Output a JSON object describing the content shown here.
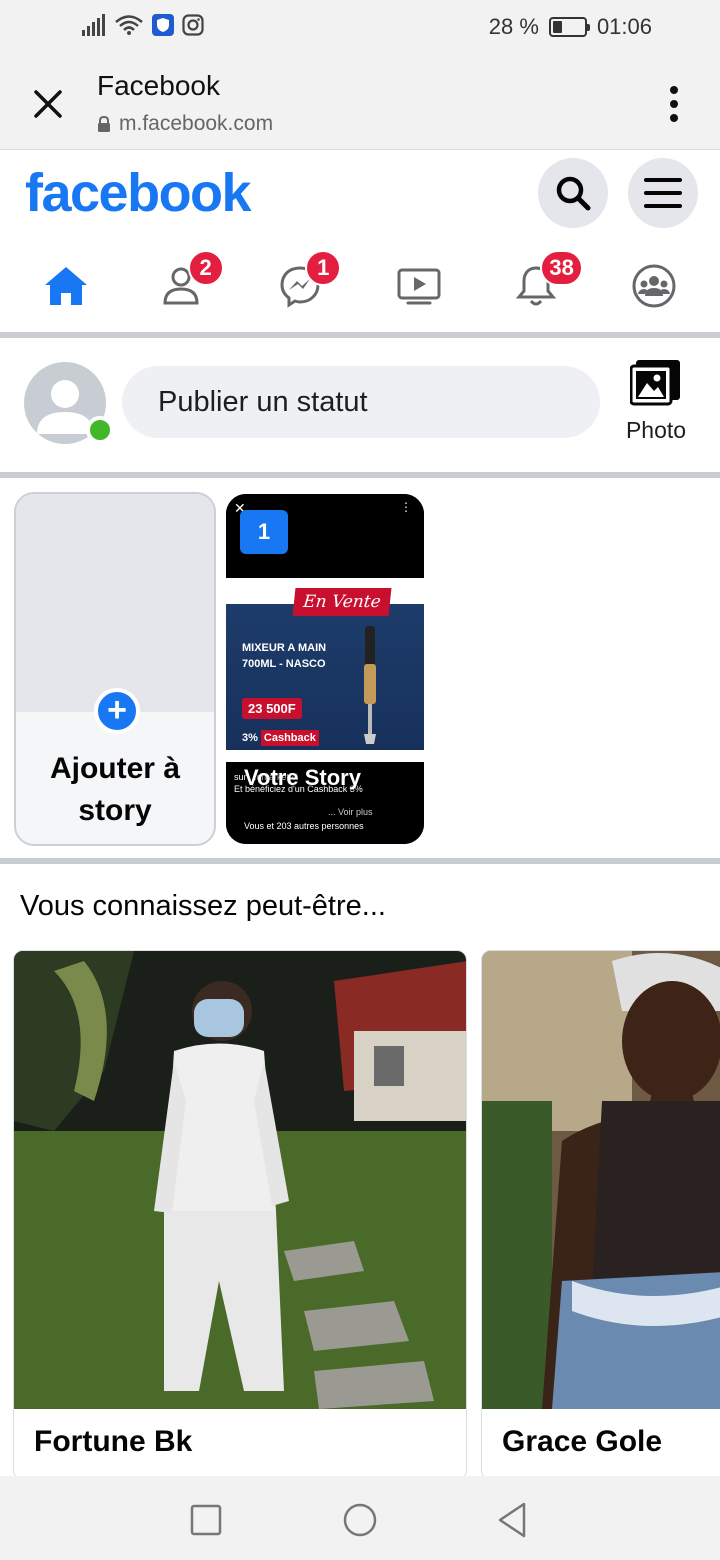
{
  "status_bar": {
    "battery": "28 %",
    "battery_level_percent": 28,
    "time": "01:06"
  },
  "browser": {
    "title": "Facebook",
    "url": "m.facebook.com"
  },
  "header": {
    "logo": "facebook"
  },
  "nav": {
    "friends_badge": "2",
    "messenger_badge": "1",
    "notifications_badge": "38"
  },
  "composer": {
    "placeholder": "Publier un statut",
    "photo_label": "Photo"
  },
  "stories": {
    "add_label": "Ajouter à story",
    "card": {
      "number": "1",
      "ad_banner": "En Vente",
      "ad_title": "MIXEUR A MAIN 700ML - NASCO",
      "ad_price": "23 500F",
      "ad_cashback_prefix": "3%",
      "ad_cashback": "Cashback",
      "line1": "sur ...dmarket.ci",
      "line2": "Et bénéficiez d'un Cashback 3%",
      "see_more": "... Voir plus",
      "likes": "Vous et 203 autres personnes",
      "label": "Votre Story"
    }
  },
  "pymk": {
    "title": "Vous connaissez peut-être...",
    "people": [
      {
        "name": "Fortune Bk"
      },
      {
        "name": "Grace Gole"
      }
    ]
  },
  "colors": {
    "brand": "#1877f2",
    "badge": "#e41e3f",
    "online": "#42b72a"
  }
}
